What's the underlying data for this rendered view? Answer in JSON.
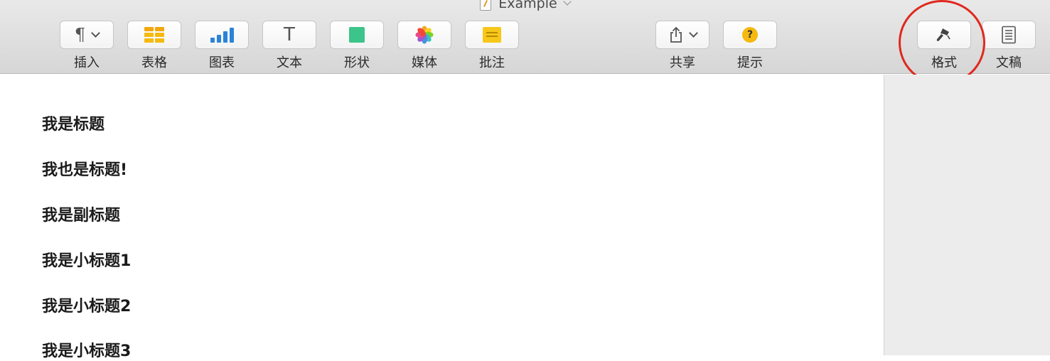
{
  "window": {
    "title": "Example"
  },
  "toolbar": {
    "tools": [
      {
        "id": "insert",
        "label": "插入",
        "icon": "pilcrow-icon",
        "has_menu": true
      },
      {
        "id": "table",
        "label": "表格",
        "icon": "table-icon"
      },
      {
        "id": "chart",
        "label": "图表",
        "icon": "chart-icon"
      },
      {
        "id": "text",
        "label": "文本",
        "icon": "text-icon"
      },
      {
        "id": "shape",
        "label": "形状",
        "icon": "shape-icon"
      },
      {
        "id": "media",
        "label": "媒体",
        "icon": "photos-icon"
      },
      {
        "id": "comment",
        "label": "批注",
        "icon": "note-icon"
      },
      {
        "id": "share",
        "label": "共享",
        "icon": "share-icon",
        "has_menu": true
      },
      {
        "id": "tips",
        "label": "提示",
        "icon": "help-icon"
      },
      {
        "id": "format",
        "label": "格式",
        "icon": "paintbrush-icon"
      },
      {
        "id": "document",
        "label": "文稿",
        "icon": "document-icon"
      }
    ],
    "icon_glyphs": {
      "pilcrow": "¶",
      "text": "T",
      "help": "?"
    }
  },
  "colors": {
    "annotation": "#e0281e",
    "table": "#f5b90f",
    "chart": "#2a83d8",
    "shape": "#3cc48a",
    "note": "#f7c71a"
  },
  "document": {
    "lines": [
      "我是标题",
      "我也是标题!",
      "我是副标题",
      "我是小标题1",
      "我是小标题2",
      "我是小标题3"
    ]
  }
}
